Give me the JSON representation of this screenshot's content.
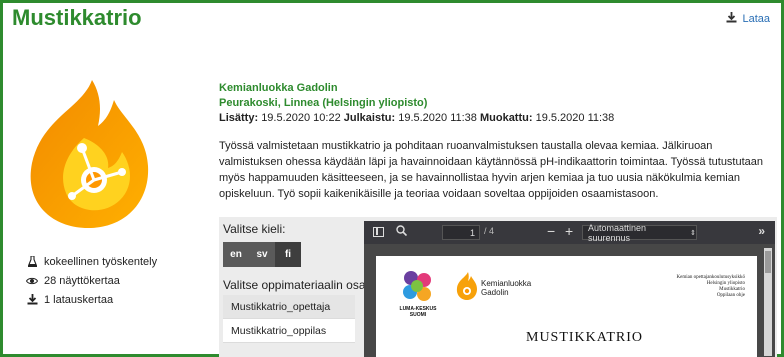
{
  "header": {
    "title": "Mustikkatrio",
    "download_label": "Lataa"
  },
  "sidebar": {
    "stats": [
      {
        "icon": "flask-icon",
        "text": "kokeellinen työskentely"
      },
      {
        "icon": "eye-icon",
        "text": "28 näyttökertaa"
      },
      {
        "icon": "download-icon",
        "text": "1 latauskertaa"
      }
    ]
  },
  "meta": {
    "organization": "Kemianluokka Gadolin",
    "author": "Peurakoski, Linnea (Helsingin yliopisto)",
    "added_label": "Lisätty:",
    "added_value": "19.5.2020 10:22",
    "published_label": "Julkaistu:",
    "published_value": "19.5.2020 11:38",
    "modified_label": "Muokattu:",
    "modified_value": "19.5.2020 11:38"
  },
  "description": "Työssä valmistetaan mustikkatrio ja pohditaan ruoanvalmistuksen taustalla olevaa kemiaa. Jälkiruoan valmistuksen ohessa käydään läpi ja havainnoidaan käytännössä pH-indikaattorin toimintaa. Työssä tutustutaan myös happamuuden käsitteeseen, ja se havainnollistaa hyvin arjen kemiaa ja tuo uusia näkökulmia kemian opiskeluun. Työ sopii kaikenikäisille ja teoriaa voidaan soveltaa oppijoiden osaamistasoon.",
  "panel": {
    "language_label": "Valitse kieli:",
    "languages": [
      "en",
      "sv",
      "fi"
    ],
    "active_language": "fi",
    "part_label": "Valitse oppimateriaalin osa:",
    "parts": [
      "Mustikkatrio_opettaja",
      "Mustikkatrio_oppilas"
    ],
    "selected_part": "Mustikkatrio_oppilas"
  },
  "viewer": {
    "current_page": "1",
    "total_pages": "/ 4",
    "zoom_out": "−",
    "zoom_in": "+",
    "zoom_option": "Automaattinen suurennus",
    "more": "»",
    "pdf": {
      "luma_text": "LUMA-KESKUS SUOMI",
      "kg_line1": "Kemianluokka",
      "kg_line2": "Gadolin",
      "right_lines": [
        "Kemian opettajankoulutusyksikkö",
        "Helsingin yliopisto",
        "Mustikkatrio",
        "Oppilaan ohje"
      ],
      "title": "MUSTIKKATRIO"
    }
  },
  "colors": {
    "brand_green": "#2e8b2e",
    "link_blue": "#2a6fb5",
    "logo_orange": "#f7a10a",
    "logo_yellow": "#ffd21f"
  }
}
